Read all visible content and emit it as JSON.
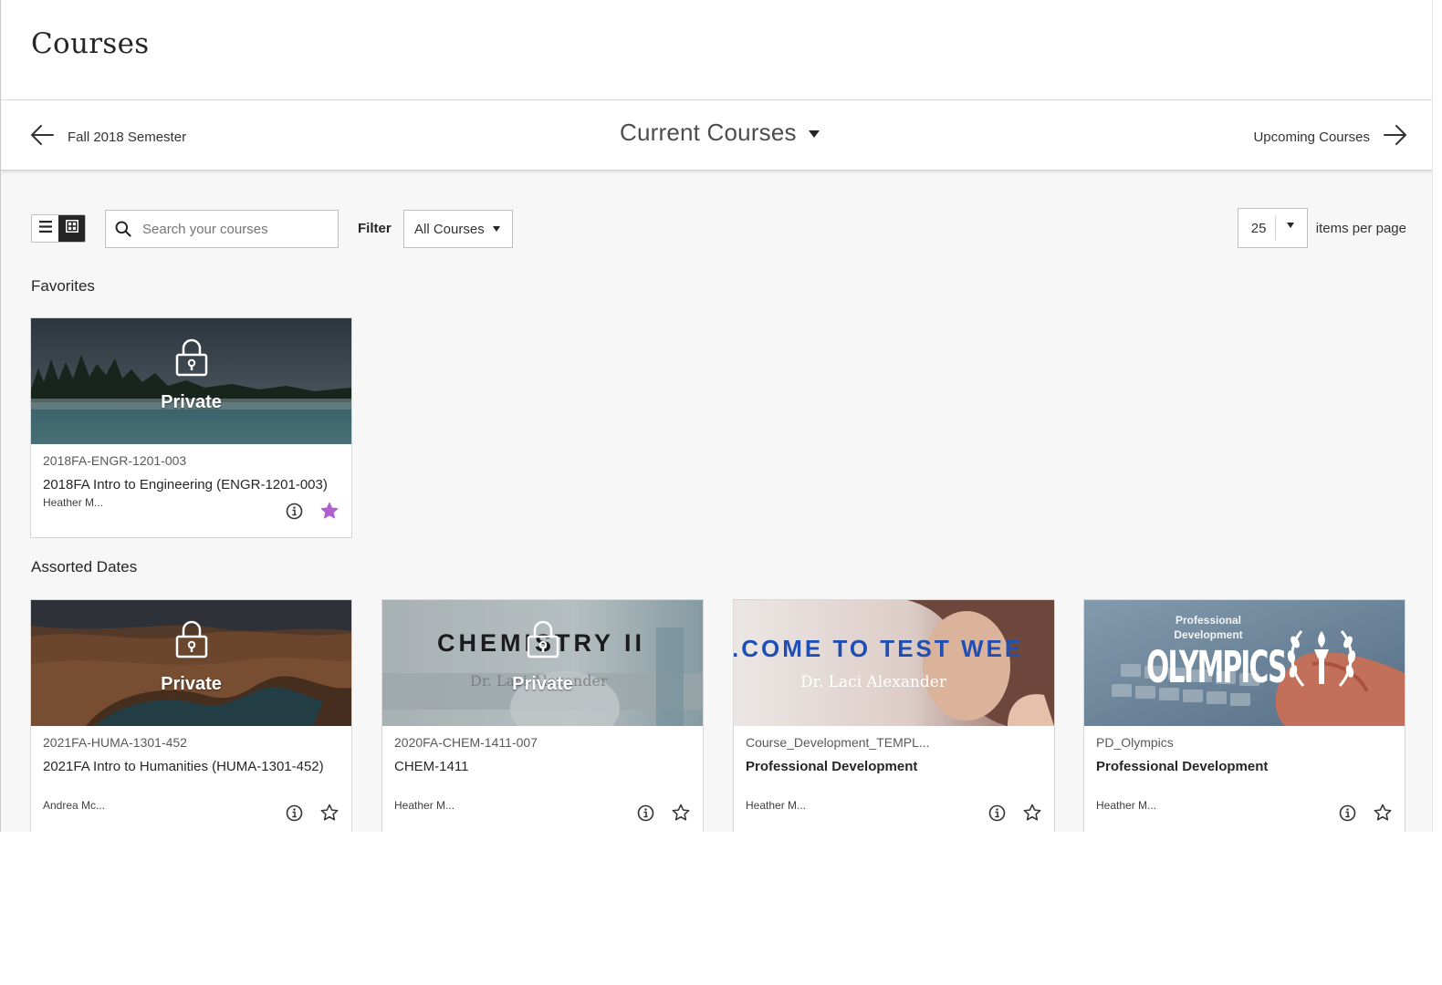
{
  "header": {
    "title": "Courses"
  },
  "term_nav": {
    "previous_label": "Fall 2018 Semester",
    "current_label": "Current Courses",
    "next_label": "Upcoming Courses"
  },
  "toolbar": {
    "search_placeholder": "Search your courses",
    "filter_label": "Filter",
    "filter_value": "All Courses",
    "per_page_value": "25",
    "per_page_label": "items per page"
  },
  "sections": [
    {
      "title": "Favorites",
      "courses": [
        {
          "id": "2018FA-ENGR-1201-003",
          "name": "2018FA Intro to Engineering (ENGR-1201-003)",
          "instructor": "Heather M...",
          "private_label": "Private",
          "favorite": true,
          "banner": "misty-lake-forest"
        }
      ]
    },
    {
      "title": "Assorted Dates",
      "courses": [
        {
          "id": "2021FA-HUMA-1301-452",
          "name": "2021FA Intro to Humanities (HUMA-1301-452)",
          "instructor": "Andrea Mc...",
          "private_label": "Private",
          "favorite": false,
          "banner": "canyon-river-bend"
        },
        {
          "id": "2020FA-CHEM-1411-007",
          "name": "CHEM-1411",
          "instructor": "Heather M...",
          "private_label": "Private",
          "favorite": false,
          "banner": "chemistry-glassware",
          "banner_title": "CHEMISTRY II",
          "banner_subtitle": "Dr. Laci Alexander"
        },
        {
          "id": "Course_Development_TEMPL...",
          "name": "Professional Development",
          "instructor": "Heather M...",
          "favorite": false,
          "banner": "woman-thinking",
          "banner_title": ".COME TO TEST WEE",
          "banner_subtitle": "Dr. Laci Alexander"
        },
        {
          "id": "PD_Olympics",
          "name": "Professional Development",
          "instructor": "Heather M...",
          "favorite": false,
          "banner": "keyboard-olympics",
          "banner_kicker": "Professional Development",
          "banner_title": "OLYMPICS"
        }
      ]
    }
  ],
  "colors": {
    "accent_dark": "#262626",
    "favorite_star": "#b05fd0",
    "banner_blue_text": "#1f4fb5"
  },
  "icons": {
    "back": "arrow-left-icon",
    "forward": "arrow-right-icon",
    "list_view": "list-view-icon",
    "grid_view": "grid-view-icon",
    "search": "search-icon",
    "lock": "lock-icon",
    "info": "info-icon",
    "star": "star-icon"
  }
}
